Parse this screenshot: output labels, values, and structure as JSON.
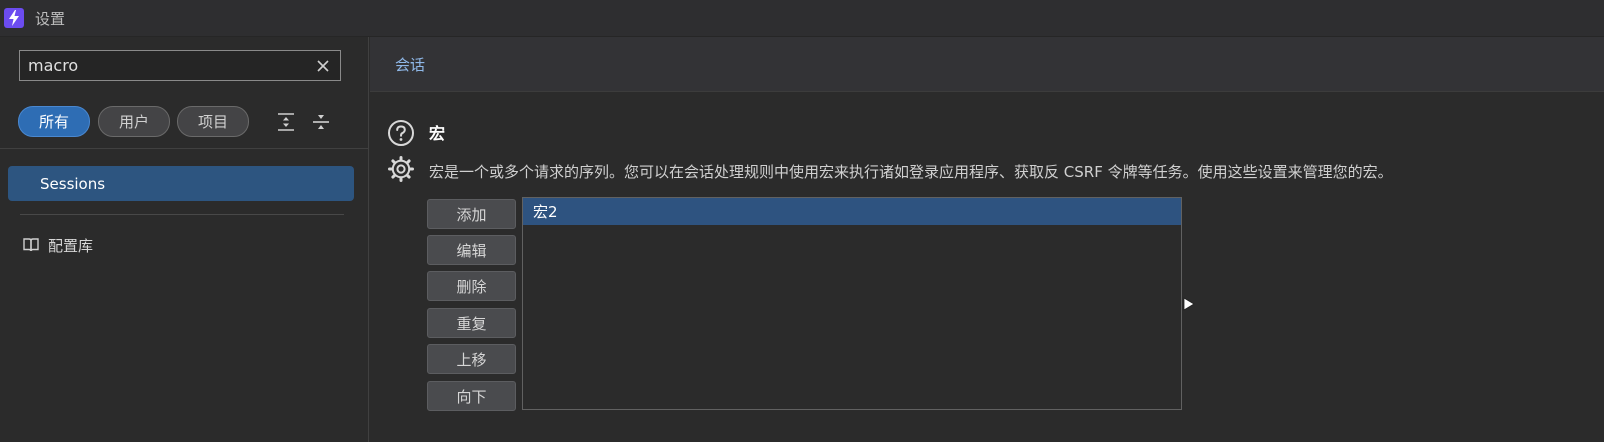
{
  "window": {
    "title": "设置",
    "logo_icon": "lightning-bolt-icon",
    "logo_color": "#6c4cf0"
  },
  "sidebar": {
    "search": {
      "value": "macro",
      "placeholder": ""
    },
    "filters": [
      {
        "label": "所有",
        "active": true
      },
      {
        "label": "用户",
        "active": false
      },
      {
        "label": "项目",
        "active": false
      }
    ],
    "nav": {
      "sessions_label": "Sessions",
      "library_label": "配置库"
    }
  },
  "main": {
    "header_label": "会话",
    "section": {
      "title": "宏",
      "description": "宏是一个或多个请求的序列。您可以在会话处理规则中使用宏来执行诸如登录应用程序、获取反 CSRF 令牌等任务。使用这些设置来管理您的宏。"
    },
    "buttons": {
      "add": "添加",
      "edit": "编辑",
      "delete": "删除",
      "duplicate": "重复",
      "move_up": "上移",
      "move_down": "向下"
    },
    "macros": [
      "宏2"
    ]
  },
  "colors": {
    "accent": "#2e6db4",
    "selection": "#2e5380",
    "link": "#8fb8e8"
  }
}
